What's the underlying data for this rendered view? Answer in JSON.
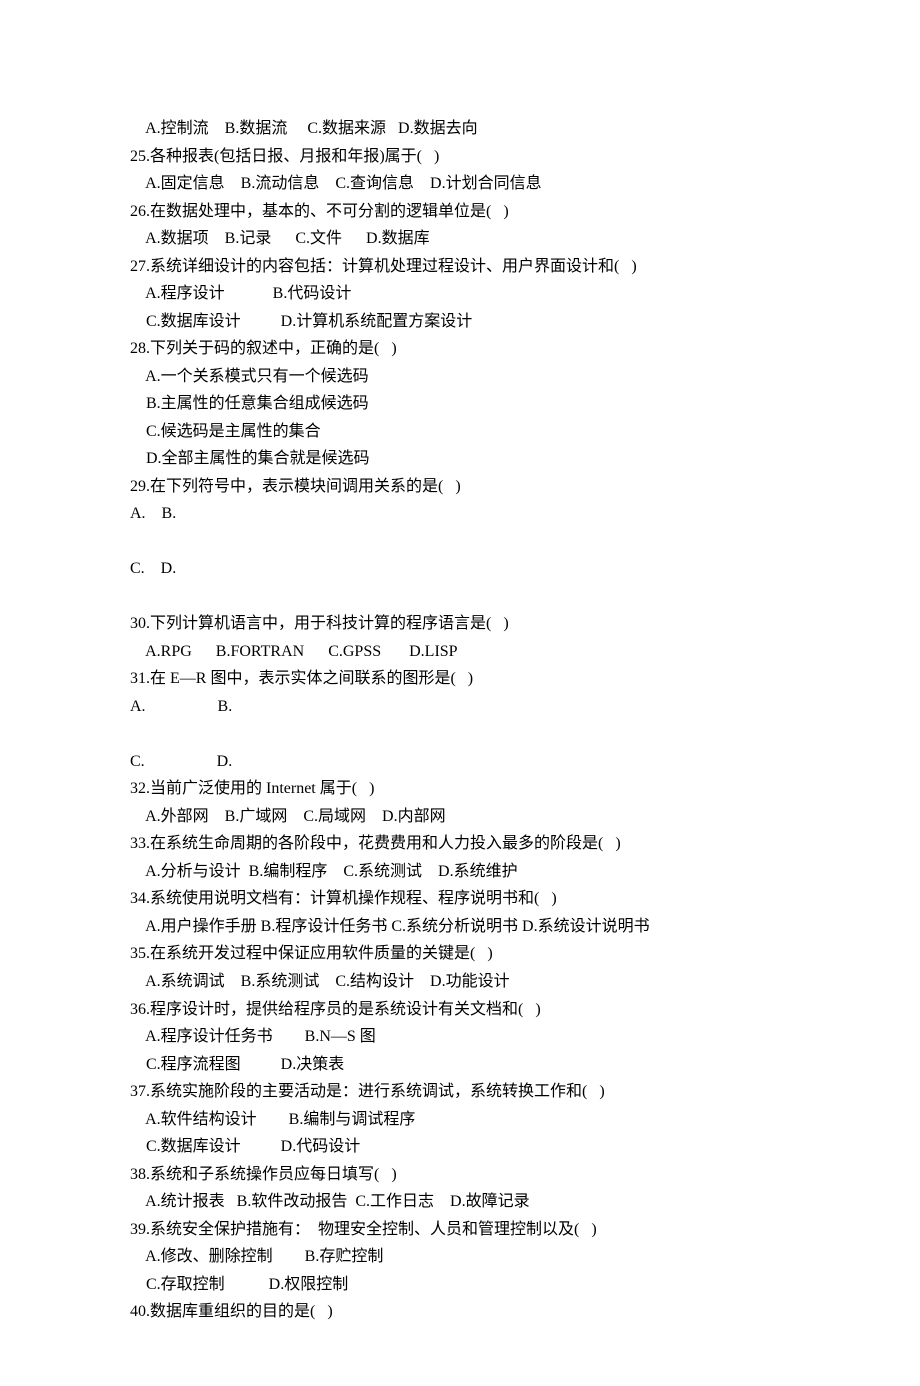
{
  "lines": {
    "q24opts": "  A.控制流    B.数据流     C.数据来源   D.数据去向",
    "q25": "25.各种报表(包括日报、月报和年报)属于(   )",
    "q25opts": "  A.固定信息    B.流动信息    C.查询信息    D.计划合同信息",
    "q26": "26.在数据处理中，基本的、不可分割的逻辑单位是(   )",
    "q26opts": "  A.数据项    B.记录      C.文件      D.数据库",
    "q27": "27.系统详细设计的内容包括：计算机处理过程设计、用户界面设计和(   )",
    "q27a": "  A.程序设计            B.代码设计",
    "q27c": "  C.数据库设计          D.计算机系统配置方案设计",
    "q28": "28.下列关于码的叙述中，正确的是(   )",
    "q28a": "  A.一个关系模式只有一个候选码",
    "q28b": "  B.主属性的任意集合组成候选码",
    "q28c": "  C.候选码是主属性的集合",
    "q28d": "  D.全部主属性的集合就是候选码",
    "q29": "29.在下列符号中，表示模块间调用关系的是(   )",
    "q29ab": "A.    B.",
    "q29cd": "C.    D.",
    "q30": "30.下列计算机语言中，用于科技计算的程序语言是(   )",
    "q30opts": "  A.RPG      B.FORTRAN      C.GPSS       D.LISP",
    "q31": "31.在 E—R 图中，表示实体之间联系的图形是(   )",
    "q31ab": "A.                  B.",
    "q31cd": "C.                  D.",
    "q32": "32.当前广泛使用的 Internet 属于(   )",
    "q32opts": "  A.外部网    B.广域网    C.局域网    D.内部网",
    "q33": "33.在系统生命周期的各阶段中，花费费用和人力投入最多的阶段是(   )",
    "q33opts": "  A.分析与设计  B.编制程序    C.系统测试    D.系统维护",
    "q34": "34.系统使用说明文档有：计算机操作规程、程序说明书和(   )",
    "q34opts": "  A.用户操作手册 B.程序设计任务书 C.系统分析说明书 D.系统设计说明书",
    "q35": "35.在系统开发过程中保证应用软件质量的关键是(   )",
    "q35opts": "  A.系统调试    B.系统测试    C.结构设计    D.功能设计",
    "q36": "36.程序设计时，提供给程序员的是系统设计有关文档和(   )",
    "q36a": "  A.程序设计任务书        B.N—S 图",
    "q36c": "  C.程序流程图          D.决策表",
    "q37": "37.系统实施阶段的主要活动是：进行系统调试，系统转换工作和(   )",
    "q37a": "  A.软件结构设计        B.编制与调试程序",
    "q37c": "  C.数据库设计          D.代码设计",
    "q38": "38.系统和子系统操作员应每日填写(   )",
    "q38opts": "  A.统计报表   B.软件改动报告  C.工作日志    D.故障记录",
    "q39": "39.系统安全保护措施有：  物理安全控制、人员和管理控制以及(   )",
    "q39a": "  A.修改、删除控制        B.存贮控制",
    "q39c": "  C.存取控制           D.权限控制",
    "q40": "40.数据库重组织的目的是(   )"
  }
}
